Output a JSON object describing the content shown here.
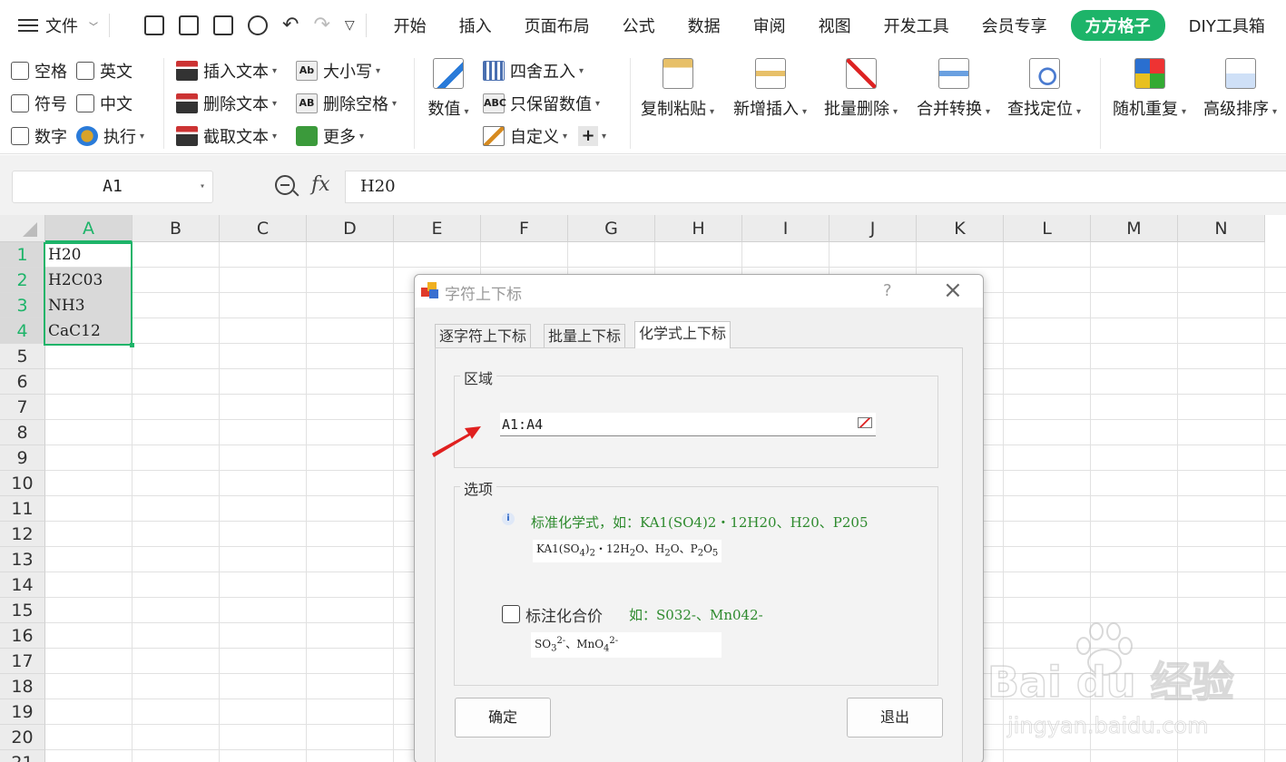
{
  "menubar": {
    "file_label": "文件",
    "tabs": [
      {
        "label": "开始"
      },
      {
        "label": "插入"
      },
      {
        "label": "页面布局"
      },
      {
        "label": "公式"
      },
      {
        "label": "数据"
      },
      {
        "label": "审阅"
      },
      {
        "label": "视图"
      },
      {
        "label": "开发工具"
      },
      {
        "label": "会员专享"
      },
      {
        "label": "方方格子",
        "active": true
      },
      {
        "label": "DIY工具箱"
      }
    ]
  },
  "ribbon": {
    "checkboxes": [
      "空格",
      "英文",
      "符号",
      "中文",
      "数字"
    ],
    "exec_label": "执行",
    "text_tools": [
      "插入文本",
      "删除文本",
      "截取文本"
    ],
    "case_tools": [
      "大小写",
      "删除空格",
      "更多"
    ],
    "number_label": "数值",
    "round_tools": [
      "四舍五入",
      "只保留数值",
      "自定义"
    ],
    "big_buttons": [
      "复制粘贴",
      "新增插入",
      "批量删除",
      "合并转换",
      "查找定位",
      "随机重复",
      "高级排序"
    ]
  },
  "formula_bar": {
    "name_box": "A1",
    "fx_label": "fx",
    "formula": "H20"
  },
  "sheet": {
    "columns": [
      "A",
      "B",
      "C",
      "D",
      "E",
      "F",
      "G",
      "H",
      "I",
      "J",
      "K",
      "L",
      "M",
      "N"
    ],
    "rows": [
      "1",
      "2",
      "3",
      "4",
      "5",
      "6",
      "7",
      "8",
      "9",
      "10",
      "11",
      "12",
      "13",
      "14",
      "15",
      "16",
      "17",
      "18",
      "19",
      "20",
      "21"
    ],
    "cells_a": [
      "H20",
      "H2C03",
      "NH3",
      "CaC12"
    ],
    "selected_column": "A"
  },
  "dialog": {
    "title": "字符上下标",
    "help": "?",
    "tabs": [
      "逐字符上下标",
      "批量上下标",
      "化学式上下标"
    ],
    "active_tab": 2,
    "region_label": "区域",
    "range_value": "A1:A4",
    "options_label": "选项",
    "formula_hint": "标准化学式，如：KA1(SO4)2・12H20、H20、P205",
    "valence_label": "标注化合价",
    "valence_hint": "如：S032-、Mn042-",
    "valence_checked": false,
    "ok_label": "确定",
    "exit_label": "退出"
  },
  "watermark": {
    "logo": "Bai  du 经验",
    "url": "jingyan.baidu.com"
  },
  "colors": {
    "accent": "#1db469",
    "hint_green": "#2d8a2d",
    "arrow_red": "#e0201f"
  }
}
